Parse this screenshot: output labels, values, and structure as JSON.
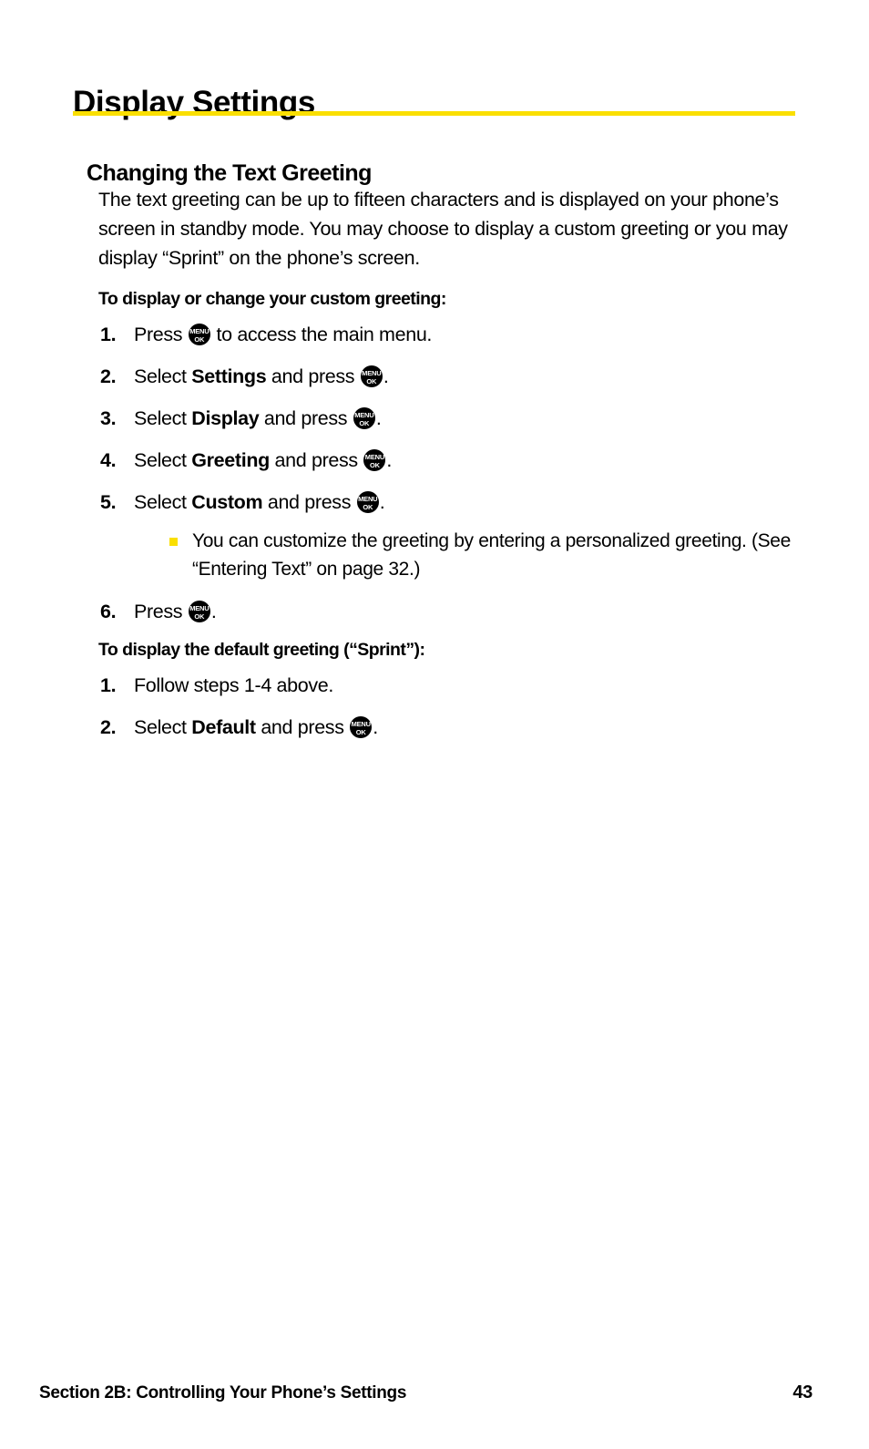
{
  "page_title": "Display Settings",
  "accent_color": "#fadf00",
  "section": {
    "heading": "Changing the Text Greeting",
    "intro": "The text greeting can be up to fifteen characters and is displayed on your phone’s screen in standby mode. You may choose to display a custom greeting or you may display “Sprint” on the phone’s screen."
  },
  "procedure_custom": {
    "heading": "To display or change your custom greeting:",
    "steps": [
      {
        "num": "1.",
        "pre": "Press ",
        "bold": "",
        "post": " to access the main menu.",
        "icon": "menu-ok-key-icon"
      },
      {
        "num": "2.",
        "pre": "Select ",
        "bold": "Settings",
        "post": " and press ",
        "tail": ".",
        "icon": "menu-ok-key-icon"
      },
      {
        "num": "3.",
        "pre": "Select ",
        "bold": "Display",
        "post": " and press ",
        "tail": ".",
        "icon": "menu-ok-key-icon"
      },
      {
        "num": "4.",
        "pre": "Select ",
        "bold": "Greeting",
        "post": " and press ",
        "tail": ".",
        "icon": "menu-ok-key-icon"
      },
      {
        "num": "5.",
        "pre": "Select ",
        "bold": "Custom",
        "post": " and press ",
        "tail": ".",
        "icon": "menu-ok-key-icon"
      },
      {
        "num": "6.",
        "pre": "Press ",
        "bold": "",
        "post": "",
        "tail": ".",
        "icon": "menu-ok-key-icon"
      }
    ],
    "subbullet": "You can customize the greeting by entering a personalized greeting. (See “Entering Text” on page 32.)"
  },
  "procedure_default": {
    "heading": "To display the default greeting (“Sprint”):",
    "steps": [
      {
        "num": "1.",
        "pre": "Follow steps 1-4 above.",
        "bold": "",
        "post": "",
        "tail": ""
      },
      {
        "num": "2.",
        "pre": "Select ",
        "bold": "Default",
        "post": " and press ",
        "tail": ".",
        "icon": "menu-ok-key-icon"
      }
    ]
  },
  "key_icon": {
    "line1": "MENU",
    "line2": "OK"
  },
  "footer": {
    "section_label": "Section 2B: Controlling Your Phone’s Settings",
    "page_number": "43"
  }
}
